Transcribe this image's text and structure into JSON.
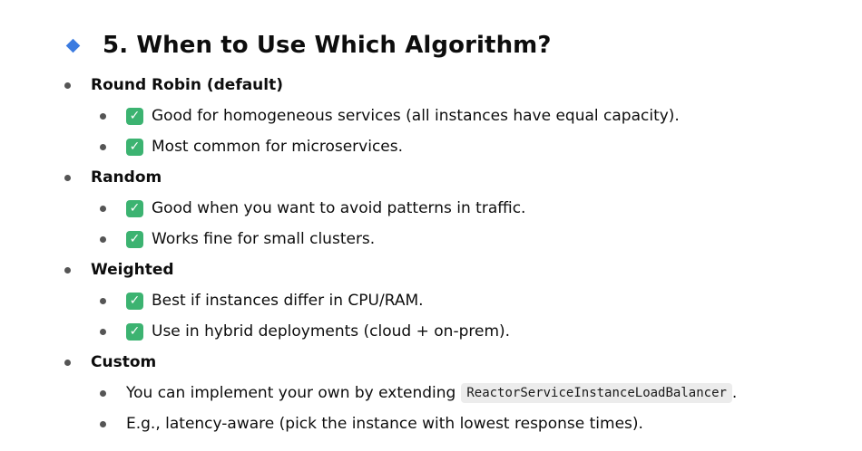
{
  "heading": {
    "icon": "diamond-icon",
    "icon_color": "#3b7be0",
    "title": "5. When to Use Which Algorithm?"
  },
  "sections": [
    {
      "title": "Round Robin (default)",
      "items": [
        "Good for homogeneous services (all instances have equal capacity).",
        "Most common for microservices."
      ]
    },
    {
      "title": "Random",
      "items": [
        "Good when you want to avoid patterns in traffic.",
        "Works fine for small clusters."
      ]
    },
    {
      "title": "Weighted",
      "items": [
        "Best if instances differ in CPU/RAM.",
        "Use in hybrid deployments (cloud + on-prem)."
      ]
    },
    {
      "title": "Custom",
      "items": [
        {
          "text": "You can implement your own by extending",
          "code": "ReactorServiceInstanceLoadBalancer",
          "suffix": "."
        },
        "E.g., latency-aware (pick the instance with lowest response times)."
      ]
    }
  ],
  "check_icon": {
    "name": "check-mark-icon",
    "glyph": "✓",
    "color": "#3cb371"
  }
}
